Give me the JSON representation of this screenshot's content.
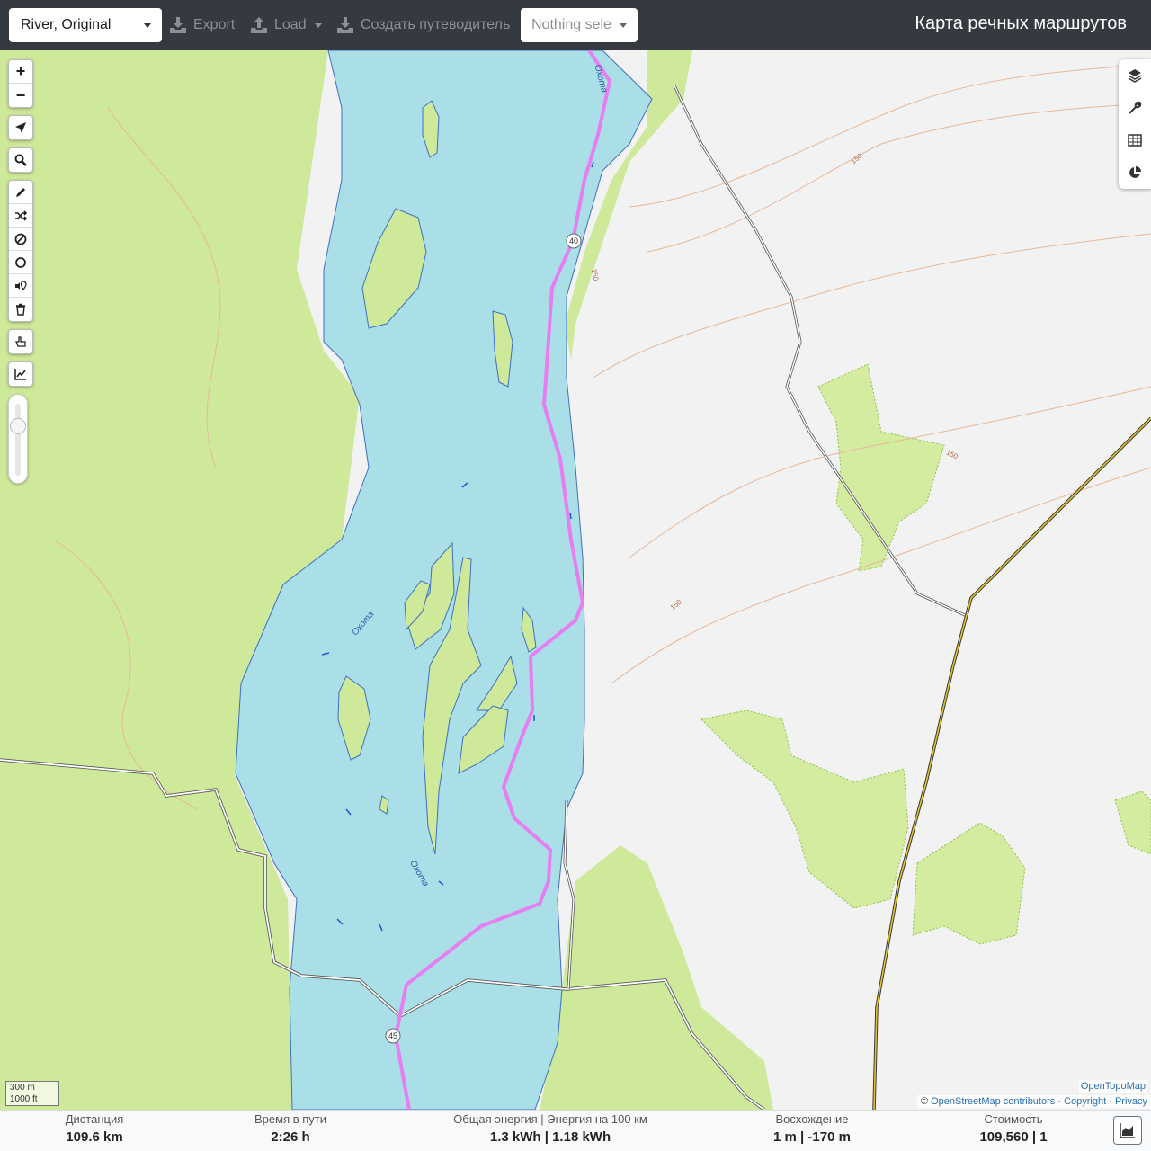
{
  "header": {
    "profile_select": "River, Original",
    "export_label": "Export",
    "load_label": "Load",
    "guide_label": "Создать путеводитель",
    "nothing_selected": "Nothing sele",
    "app_title": "Карта речных маршрутов"
  },
  "map": {
    "zoom_in": "+",
    "zoom_out": "−",
    "route_markers": [
      "40",
      "45"
    ],
    "river_labels": [
      "Охота",
      "Охота",
      "Охота"
    ],
    "contour_labels": [
      "150",
      "150",
      "150",
      "150"
    ],
    "scale_metric": "300 m",
    "scale_imperial": "1000 ft",
    "attribution_layer": "OpenTopoMap",
    "attribution_prefix": "©",
    "attribution_osm": "OpenStreetMap contributors",
    "attribution_sep1": "·",
    "attribution_copyright": "Copyright",
    "attribution_sep2": "·",
    "attribution_privacy": "Privacy",
    "colors": {
      "water": "#aadfe8",
      "forest": "#d4eca0",
      "route": "#e67ef2",
      "land": "#f2f2f2"
    }
  },
  "stats": {
    "distance": {
      "label": "Дистанция",
      "value": "109.6 km"
    },
    "time": {
      "label": "Время в пути",
      "value": "2:26 h"
    },
    "energy": {
      "label": "Общая энергия | Энергия на 100 км",
      "value": "1.3 kWh | 1.18 kWh"
    },
    "ascent": {
      "label": "Восхождение",
      "value": "1 m | -170 m"
    },
    "cost": {
      "label": "Стоимость",
      "value": "109,560 | 1"
    }
  }
}
